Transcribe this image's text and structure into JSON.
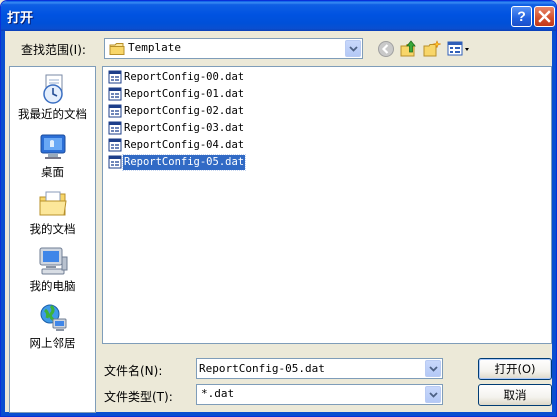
{
  "window": {
    "title": "打开",
    "help_glyph": "?",
    "colors": {
      "titlebar": "#0053e1",
      "face": "#ece9d8",
      "selection": "#316ac5"
    }
  },
  "lookin": {
    "label": "查找范围(I):",
    "value": "Template",
    "icon": "folder-icon"
  },
  "toolbar": {
    "icons": [
      "back-icon",
      "up-folder-icon",
      "new-folder-icon",
      "views-menu-icon"
    ]
  },
  "places": [
    {
      "label": "我最近的文档",
      "icon": "recent-documents-icon"
    },
    {
      "label": "桌面",
      "icon": "desktop-icon"
    },
    {
      "label": "我的文档",
      "icon": "my-documents-icon"
    },
    {
      "label": "我的电脑",
      "icon": "my-computer-icon"
    },
    {
      "label": "网上邻居",
      "icon": "network-places-icon"
    }
  ],
  "files": [
    {
      "name": "ReportConfig-00.dat",
      "selected": false
    },
    {
      "name": "ReportConfig-01.dat",
      "selected": false
    },
    {
      "name": "ReportConfig-02.dat",
      "selected": false
    },
    {
      "name": "ReportConfig-03.dat",
      "selected": false
    },
    {
      "name": "ReportConfig-04.dat",
      "selected": false
    },
    {
      "name": "ReportConfig-05.dat",
      "selected": true
    }
  ],
  "filename": {
    "label": "文件名(N):",
    "value": "ReportConfig-05.dat"
  },
  "filetype": {
    "label": "文件类型(T):",
    "value": "*.dat"
  },
  "buttons": {
    "open": "打开(O)",
    "cancel": "取消"
  }
}
